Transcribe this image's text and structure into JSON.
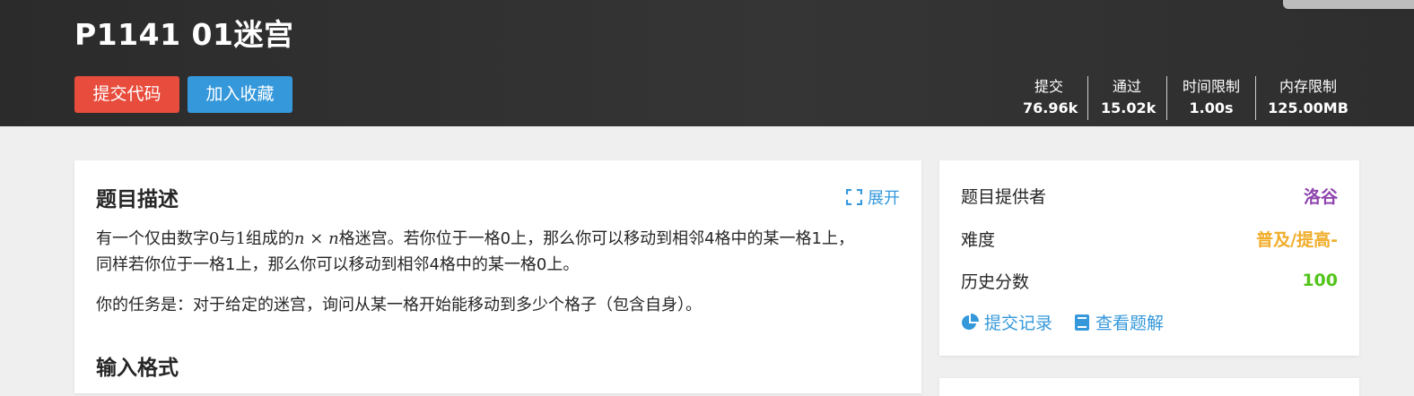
{
  "problem": {
    "title": "P1141 01迷宫"
  },
  "actions": {
    "submit_label": "提交代码",
    "favorite_label": "加入收藏"
  },
  "stats": [
    {
      "label": "提交",
      "value": "76.96k"
    },
    {
      "label": "通过",
      "value": "15.02k"
    },
    {
      "label": "时间限制",
      "value": "1.00s"
    },
    {
      "label": "内存限制",
      "value": "125.00MB"
    }
  ],
  "description": {
    "heading": "题目描述",
    "expand_label": "展开",
    "para1_a": "有一个仅由数字",
    "para1_zero": "0",
    "para1_b": "与",
    "para1_one": "1",
    "para1_c": "组成的",
    "para1_n1": "n",
    "para1_times": "×",
    "para1_n2": "n",
    "para1_d": "格迷宫。若你位于一格0上，那么你可以移动到相邻4格中的某一格1上，",
    "para1_line2": "同样若你位于一格1上，那么你可以移动到相邻4格中的某一格0上。",
    "para2": "你的任务是：对于给定的迷宫，询问从某一格开始能移动到多少个格子（包含自身）。"
  },
  "input_format": {
    "heading": "输入格式"
  },
  "sidebar": {
    "rows": [
      {
        "label": "题目提供者",
        "value": "洛谷",
        "color": "#8e44ad"
      },
      {
        "label": "难度",
        "value": "普及/提高-",
        "color": "#f0ad2a"
      },
      {
        "label": "历史分数",
        "value": "100",
        "color": "#52c41a"
      }
    ],
    "links": {
      "records_label": "提交记录",
      "solutions_label": "查看题解"
    }
  },
  "colors": {
    "accent": "#3498db",
    "danger": "#e74c3c",
    "header_bg": "#2e2e2e"
  }
}
